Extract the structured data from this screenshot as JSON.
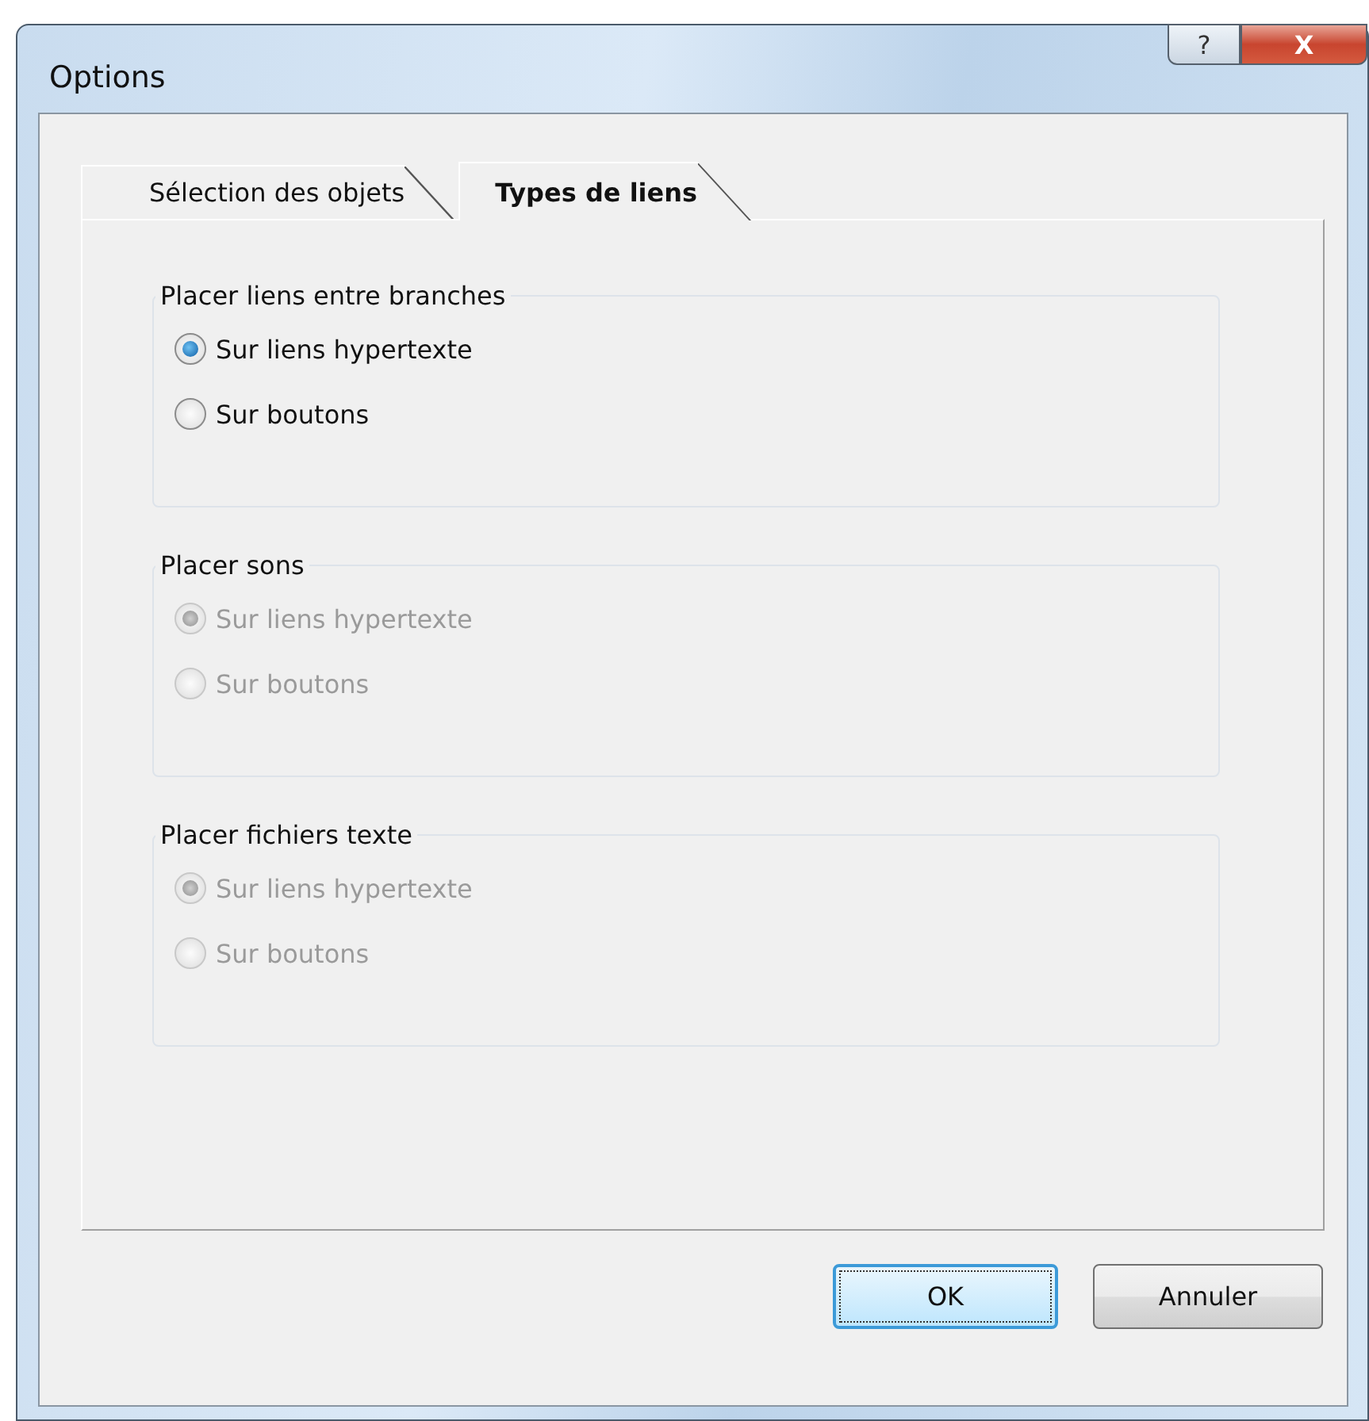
{
  "window": {
    "title": "Options",
    "help_button": "?",
    "close_button": "X"
  },
  "tabs": [
    {
      "label": "Sélection des objets",
      "selected": false
    },
    {
      "label": "Types de liens",
      "selected": true
    }
  ],
  "groups": [
    {
      "title": "Placer liens entre branches",
      "disabled": false,
      "options": [
        {
          "label": "Sur liens hypertexte",
          "selected": true
        },
        {
          "label": "Sur boutons",
          "selected": false
        }
      ]
    },
    {
      "title": "Placer sons",
      "disabled": true,
      "options": [
        {
          "label": "Sur liens hypertexte",
          "selected": true
        },
        {
          "label": "Sur boutons",
          "selected": false
        }
      ]
    },
    {
      "title": "Placer fichiers texte",
      "disabled": true,
      "options": [
        {
          "label": "Sur liens hypertexte",
          "selected": true
        },
        {
          "label": "Sur boutons",
          "selected": false
        }
      ]
    }
  ],
  "buttons": [
    {
      "label": "OK",
      "default": true
    },
    {
      "label": "Annuler",
      "default": false
    }
  ]
}
